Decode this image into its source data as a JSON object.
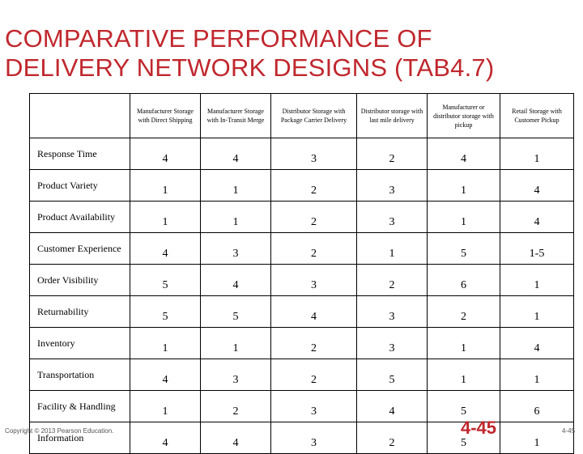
{
  "title_line1": "COMPARATIVE PERFORMANCE OF",
  "title_line2": "DELIVERY NETWORK DESIGNS (TAB4.7)",
  "table": {
    "columns": [
      "",
      "Manufacturer Storage with Direct Shipping",
      "Manufacturer Storage with In-Transit Merge",
      "Distributor Storage with Package Carrier Delivery",
      "Distributor storage with last mile delivery",
      "Manufacturer or distributor storage with pickup",
      "Retail Storage with Customer Pickup"
    ],
    "rows": [
      {
        "label": "Response Time",
        "values": [
          "4",
          "4",
          "3",
          "2",
          "4",
          "1"
        ]
      },
      {
        "label": "Product Variety",
        "values": [
          "1",
          "1",
          "2",
          "3",
          "1",
          "4"
        ]
      },
      {
        "label": "Product Availability",
        "values": [
          "1",
          "1",
          "2",
          "3",
          "1",
          "4"
        ]
      },
      {
        "label": "Customer Experience",
        "values": [
          "4",
          "3",
          "2",
          "1",
          "5",
          "1-5"
        ]
      },
      {
        "label": "Order Visibility",
        "values": [
          "5",
          "4",
          "3",
          "2",
          "6",
          "1"
        ]
      },
      {
        "label": "Returnability",
        "values": [
          "5",
          "5",
          "4",
          "3",
          "2",
          "1"
        ]
      },
      {
        "label": "Inventory",
        "values": [
          "1",
          "1",
          "2",
          "3",
          "1",
          "4"
        ]
      },
      {
        "label": "Transportation",
        "values": [
          "4",
          "3",
          "2",
          "5",
          "1",
          "1"
        ]
      },
      {
        "label": "Facility & Handling",
        "values": [
          "1",
          "2",
          "3",
          "4",
          "5",
          "6"
        ]
      },
      {
        "label": "Information",
        "values": [
          "4",
          "4",
          "3",
          "2",
          "5",
          "1"
        ]
      }
    ]
  },
  "footer": {
    "copyright": "Copyright © 2013 Pearson Education.",
    "slide_number": "4-45",
    "page_number": "4-45"
  },
  "colors": {
    "accent": "#c0282e"
  }
}
